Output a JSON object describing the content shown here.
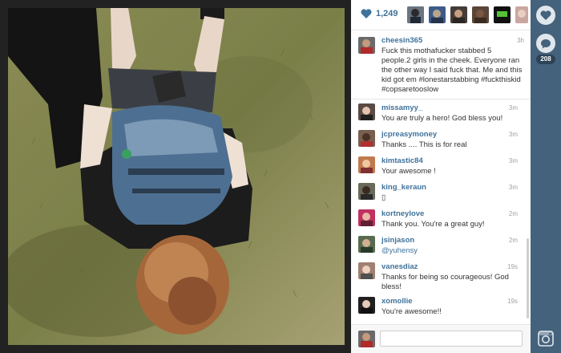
{
  "likes": {
    "count": "1,249",
    "likers": [
      "liker-1",
      "liker-2",
      "liker-3",
      "liker-4",
      "liker-5",
      "liker-6"
    ]
  },
  "caption": {
    "username": "cheesin365",
    "time": "3h",
    "text": "Fuck this mothafucker stabbed 5 people.2 girls in the cheek. Everyone ran the other way I said fuck that. Me and this kid got em #lonestarstabbing #fuckthiskid #copsaretooslow"
  },
  "comments": [
    {
      "username": "missamyy_",
      "time": "3m",
      "text": "You are truly a hero! God bless you!"
    },
    {
      "username": "jcpreasymoney",
      "time": "3m",
      "text": "Thanks .... This is for real"
    },
    {
      "username": "kimtastic84",
      "time": "3m",
      "text": "Your awesome !"
    },
    {
      "username": "king_keraun",
      "time": "3m",
      "text": "▯"
    },
    {
      "username": "kortneylove",
      "time": "2m",
      "text": "Thank you. You're a great guy!"
    },
    {
      "username": "jsinjason",
      "time": "2m",
      "text": "@yuhensy"
    },
    {
      "username": "vanesdiaz",
      "time": "19s",
      "text": "Thanks for being so courageous! God bless!"
    },
    {
      "username": "xomollie",
      "time": "19s",
      "text": "You're awesome!!"
    }
  ],
  "comment_input": {
    "placeholder": ""
  },
  "rail": {
    "comment_count": "208"
  },
  "colors": {
    "link": "#3f729b",
    "rail": "#45627c",
    "panel": "#ffffff"
  }
}
